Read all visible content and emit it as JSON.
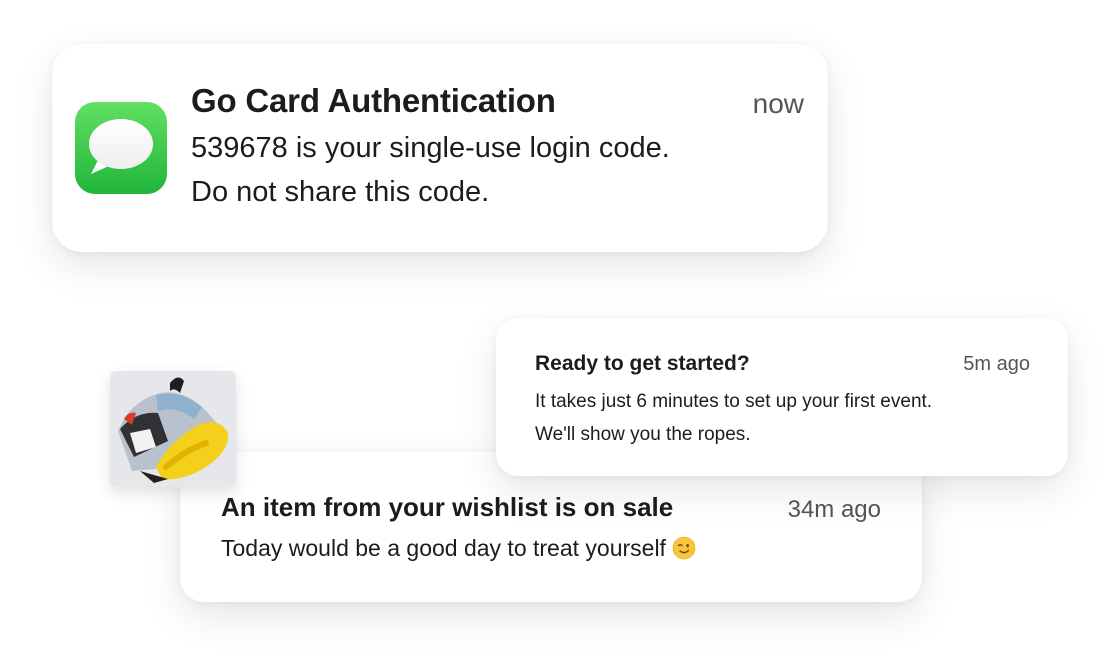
{
  "notifications": {
    "auth": {
      "app_icon": "messages-icon",
      "title": "Go Card Authentication",
      "time": "now",
      "line1": "539678 is your single-use login code.",
      "line2": "Do not share this code.",
      "icon_color": "#28c840"
    },
    "wishlist": {
      "thumbnail": "sneaker-image",
      "title": "An item from your wishlist is on sale",
      "time": "34m ago",
      "body": "Today would be a good day to treat yourself",
      "emoji": "winking-face-emoji"
    },
    "ready": {
      "title": "Ready to get started?",
      "time": "5m ago",
      "body": "It takes just 6 minutes to set up your first event. We'll show you the ropes."
    }
  }
}
